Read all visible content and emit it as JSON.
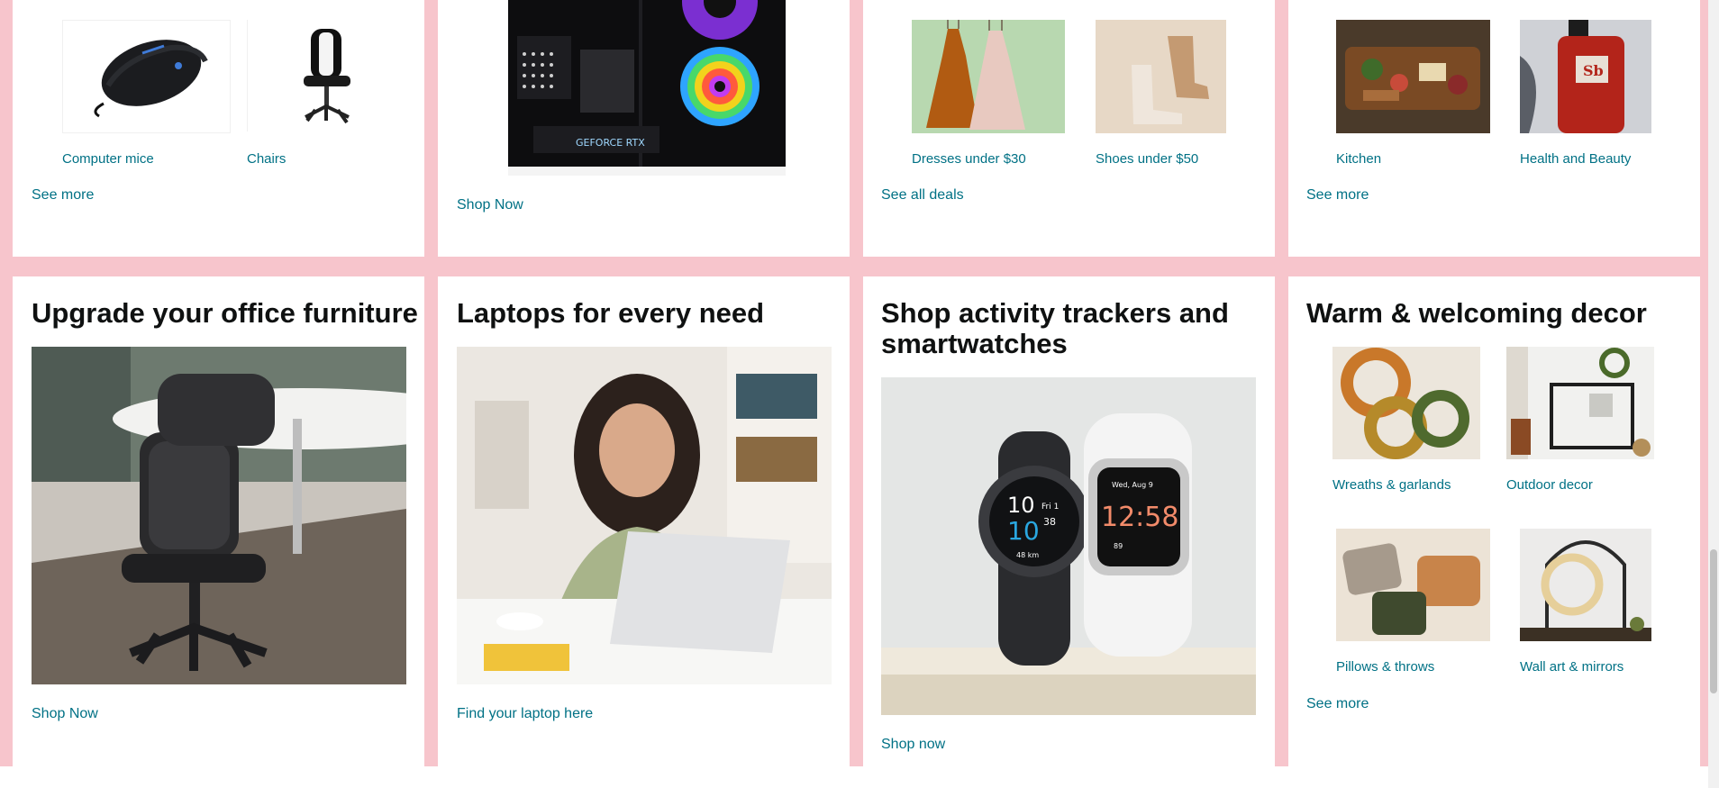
{
  "colors": {
    "page_bg": "#f7c5cc",
    "link": "#007185",
    "heading": "#0f1111"
  },
  "top_row": {
    "card1": {
      "items": [
        {
          "label": "Computer mice",
          "icon": "gaming-mouse"
        },
        {
          "label": "Chairs",
          "icon": "gaming-chair"
        }
      ],
      "link": "See more"
    },
    "card2": {
      "gpu_text": "GEFORCE RTX",
      "link": "Shop Now"
    },
    "card3": {
      "items": [
        {
          "label": "Dresses under $30"
        },
        {
          "label": "Shoes under $50"
        }
      ],
      "link": "See all deals"
    },
    "card4": {
      "items": [
        {
          "label": "Kitchen"
        },
        {
          "label": "Health and Beauty"
        }
      ],
      "bottle_logo": "Sb",
      "link": "See more"
    }
  },
  "bottom_row": {
    "office": {
      "title": "Upgrade your office furniture",
      "link": "Shop Now"
    },
    "laptops": {
      "title": "Laptops for every need",
      "link": "Find your laptop here"
    },
    "trackers": {
      "title": "Shop activity trackers and smartwatches",
      "link": "Shop now",
      "watch1": {
        "time_h": "10",
        "time_m": "10",
        "sec": "38",
        "day": "Fri 1",
        "dist": "48 km"
      },
      "watch2": {
        "date": "Wed, Aug 9",
        "time": "12:58",
        "steps": "89"
      }
    },
    "decor": {
      "title": "Warm & welcoming decor",
      "items": [
        {
          "label": "Wreaths & garlands"
        },
        {
          "label": "Outdoor decor"
        },
        {
          "label": "Pillows & throws"
        },
        {
          "label": "Wall art & mirrors"
        }
      ],
      "link": "See more"
    }
  }
}
